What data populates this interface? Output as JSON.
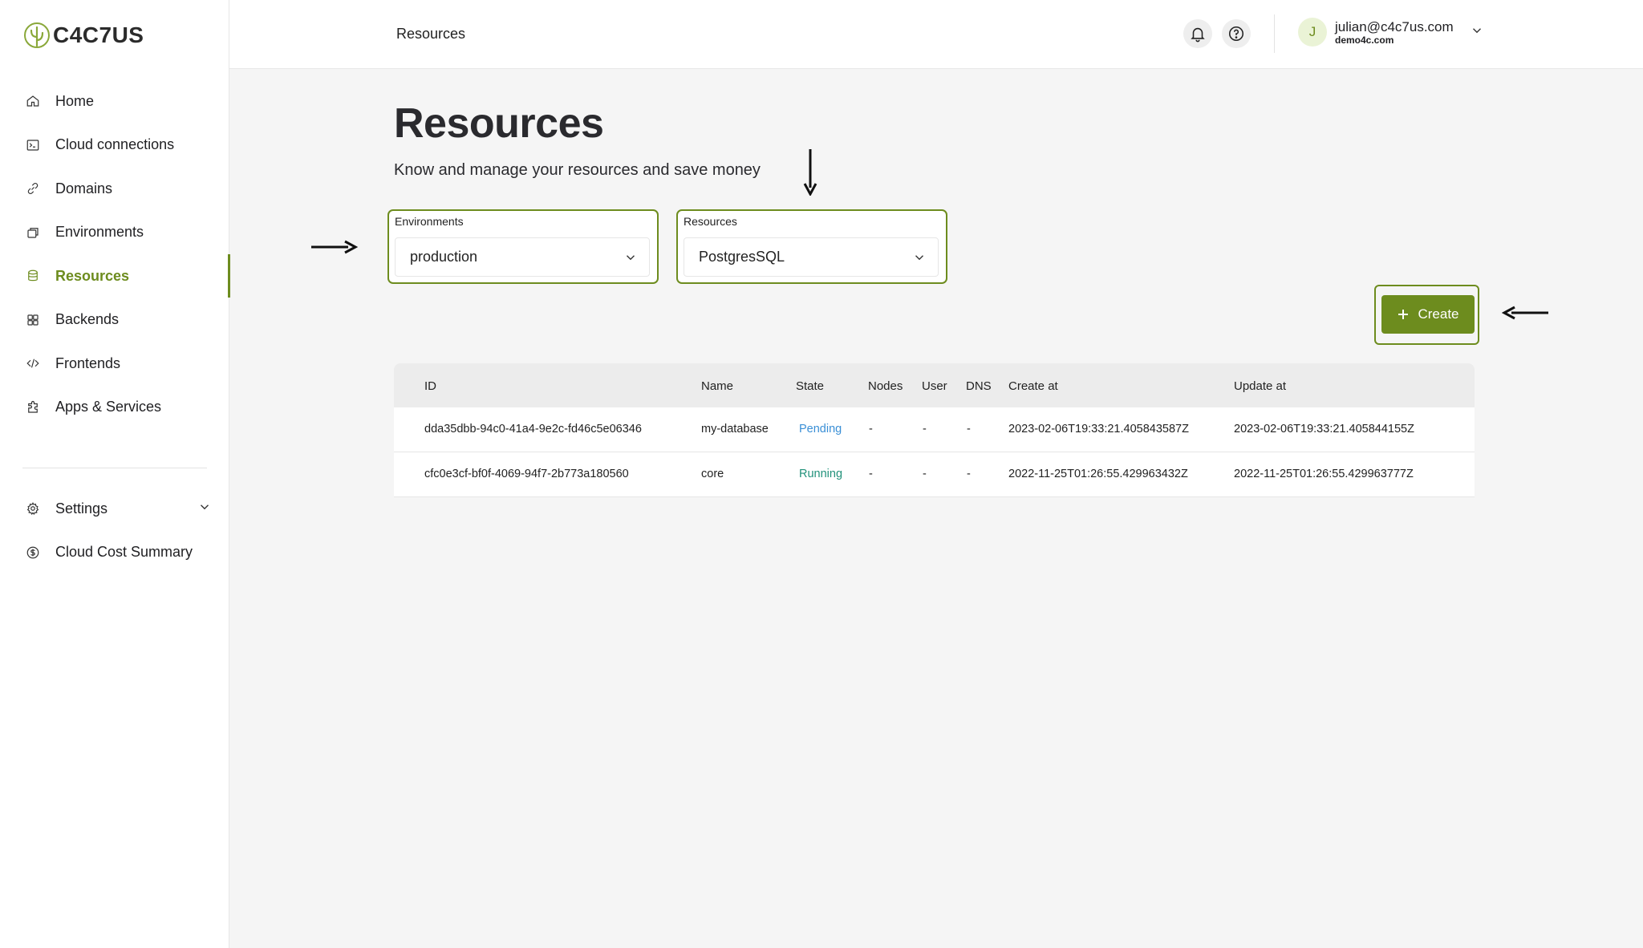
{
  "app": {
    "logo_text": "C4C7US"
  },
  "sidebar": {
    "items": [
      {
        "label": "Home",
        "icon": "home-icon"
      },
      {
        "label": "Cloud connections",
        "icon": "terminal-icon"
      },
      {
        "label": "Domains",
        "icon": "link-icon"
      },
      {
        "label": "Environments",
        "icon": "environments-icon"
      },
      {
        "label": "Resources",
        "icon": "database-icon",
        "active": true
      },
      {
        "label": "Backends",
        "icon": "grid-icon"
      },
      {
        "label": "Frontends",
        "icon": "code-icon"
      },
      {
        "label": "Apps & Services",
        "icon": "puzzle-icon"
      }
    ],
    "bottom_items": [
      {
        "label": "Settings",
        "icon": "gear-icon"
      },
      {
        "label": "Cloud Cost Summary",
        "icon": "dollar-icon"
      }
    ]
  },
  "header": {
    "breadcrumb": "Resources",
    "user": {
      "initial": "J",
      "email": "julian@c4c7us.com",
      "org": "demo4c.com"
    }
  },
  "main": {
    "title": "Resources",
    "subtitle": "Know and manage your resources and save money",
    "filters": {
      "environment": {
        "label": "Environments",
        "value": "production"
      },
      "resource": {
        "label": "Resources",
        "value": "PostgresSQL"
      }
    },
    "create_label": "Create"
  },
  "table": {
    "columns": [
      "ID",
      "Name",
      "State",
      "Nodes",
      "User",
      "DNS",
      "Create at",
      "Update at"
    ],
    "rows": [
      {
        "id": "dda35dbb-94c0-41a4-9e2c-fd46c5e06346",
        "name": "my-database",
        "state": "Pending",
        "nodes": "-",
        "user": "-",
        "dns": "-",
        "created": "2023-02-06T19:33:21.405843587Z",
        "updated": "2023-02-06T19:33:21.405844155Z"
      },
      {
        "id": "cfc0e3cf-bf0f-4069-94f7-2b773a180560",
        "name": "core",
        "state": "Running",
        "nodes": "-",
        "user": "-",
        "dns": "-",
        "created": "2022-11-25T01:26:55.429963432Z",
        "updated": "2022-11-25T01:26:55.429963777Z"
      }
    ]
  },
  "colors": {
    "accent": "#6d8c1e",
    "pending": "#3a8fd6",
    "running": "#21917a"
  }
}
